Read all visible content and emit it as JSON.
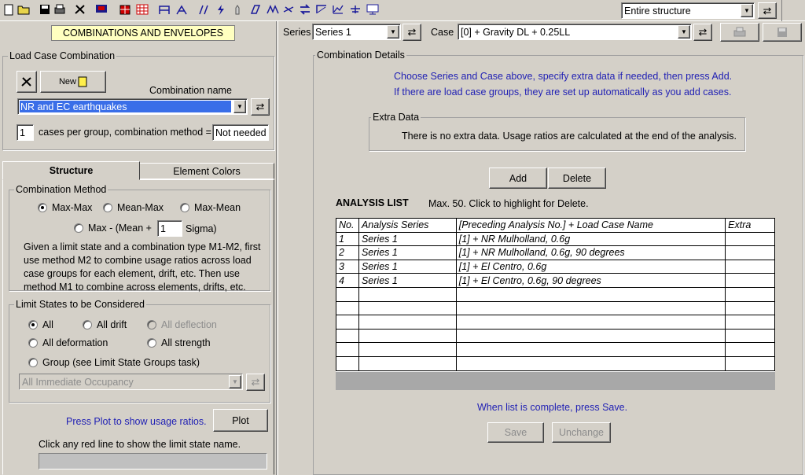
{
  "toolbar": {
    "icons": [
      "new-file-icon",
      "open-folder-icon",
      "save-disk-icon",
      "print-setup-icon",
      "tools-icon",
      "monitor-icon",
      "building-icon",
      "building-grid-icon",
      "frame-icon",
      "frame-brace-icon",
      "strut-icon",
      "lightning-icon",
      "hand-icon",
      "slab-icon",
      "hinge-icon",
      "beam-icon",
      "swap-icon",
      "node-icon",
      "curve-icon",
      "graph-icon",
      "chart-icon",
      "display-icon"
    ],
    "structure_select": "Entire structure"
  },
  "header": {
    "series_label": "Series",
    "series_value": "Series 1",
    "case_label": "Case",
    "case_value": "[0] + Gravity DL + 0.25LL"
  },
  "left": {
    "title": "COMBINATIONS AND ENVELOPES",
    "lcc_legend": "Load Case Combination",
    "new_label": "New",
    "combo_name_label": "Combination  name",
    "combo_name_value": "NR and EC earthquakes",
    "cases_per_group": "1",
    "cases_per_group_label": "cases per group, combination method =",
    "method_value": "Not needed",
    "tabs": {
      "structure": "Structure",
      "element_colors": "Element Colors"
    },
    "method_legend": "Combination Method",
    "methods": {
      "max_max": "Max-Max",
      "mean_max": "Mean-Max",
      "max_mean": "Max-Mean",
      "max_mean_sigma_prefix": "Max - (Mean +",
      "sigma_value": "1",
      "sigma_suffix": "Sigma)"
    },
    "method_desc": [
      "Given a limit state and a combination type M1-M2, first",
      "use method M2 to combine usage ratios across load",
      "case groups for each element, drift, etc. Then use",
      "method M1 to combine across elements, drifts, etc."
    ],
    "limit_legend": "Limit States to be Considered",
    "limits": {
      "all": "All",
      "all_drift": "All drift",
      "all_deflection": "All deflection",
      "all_deformation": "All deformation",
      "all_strength": "All strength",
      "group": "Group (see Limit State Groups task)"
    },
    "group_select": "All Immediate Occupancy",
    "plot_hint": "Press Plot to show usage ratios.",
    "plot_label": "Plot",
    "red_line_hint": "Click any red line to show the limit state name."
  },
  "right": {
    "details_legend": "Combination Details",
    "instr1": "Choose Series and Case above, specify extra data if needed, then press Add.",
    "instr2": "If there are load case groups, they  are set up automatically as you add cases.",
    "extra_legend": "Extra Data",
    "extra_text": "There is no extra data. Usage ratios are calculated at the end of the analysis.",
    "add_label": "Add",
    "delete_label": "Delete",
    "list_title": "ANALYSIS LIST",
    "list_hint": "Max. 50.   Click to highlight for Delete.",
    "columns": [
      "No.",
      "Analysis Series",
      "[Preceding Analysis No.] + Load Case Name",
      "Extra"
    ],
    "rows": [
      [
        "1",
        "Series 1",
        "[1] + NR Mulholland, 0.6g",
        ""
      ],
      [
        "2",
        "Series 1",
        "[1] + NR Mulholland, 0.6g, 90 degrees",
        ""
      ],
      [
        "3",
        "Series 1",
        "[1] + El Centro, 0.6g",
        ""
      ],
      [
        "4",
        "Series 1",
        "[1] + El Centro, 0.6g, 90 degrees",
        ""
      ],
      [
        "",
        "",
        "",
        ""
      ],
      [
        "",
        "",
        "",
        ""
      ],
      [
        "",
        "",
        "",
        ""
      ],
      [
        "",
        "",
        "",
        ""
      ],
      [
        "",
        "",
        "",
        ""
      ],
      [
        "",
        "",
        "",
        ""
      ]
    ],
    "save_hint": "When list is complete, press Save.",
    "save_label": "Save",
    "unchange_label": "Unchange"
  }
}
